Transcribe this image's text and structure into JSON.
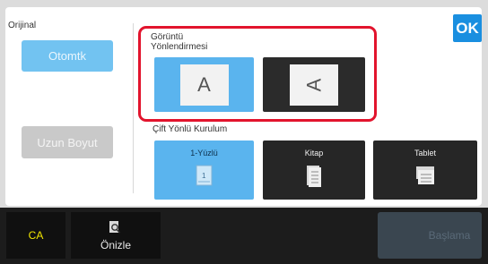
{
  "ok_label": "OK",
  "left": {
    "original_label": "Orijinal",
    "auto_button": "Otomtk",
    "long_size_button": "Uzun Boyut"
  },
  "orientation": {
    "label_line1": "Görüntü",
    "label_line2": "Yönlendirmesi",
    "portrait_glyph": "A",
    "landscape_glyph": "A"
  },
  "duplex": {
    "label": "Çift Yönlü Kurulum",
    "options": [
      {
        "label": "1-Yüzlü",
        "selected": true
      },
      {
        "label": "Kitap",
        "selected": false
      },
      {
        "label": "Tablet",
        "selected": false
      }
    ]
  },
  "bottom": {
    "ca_label": "CA",
    "preview_label": "Önizle",
    "start_label": "Başlama"
  },
  "colors": {
    "accent_blue": "#4aa8e8",
    "selected_fill": "#5ab4ee",
    "highlight_red": "#e2142d",
    "ca_yellow": "#f2e600"
  }
}
